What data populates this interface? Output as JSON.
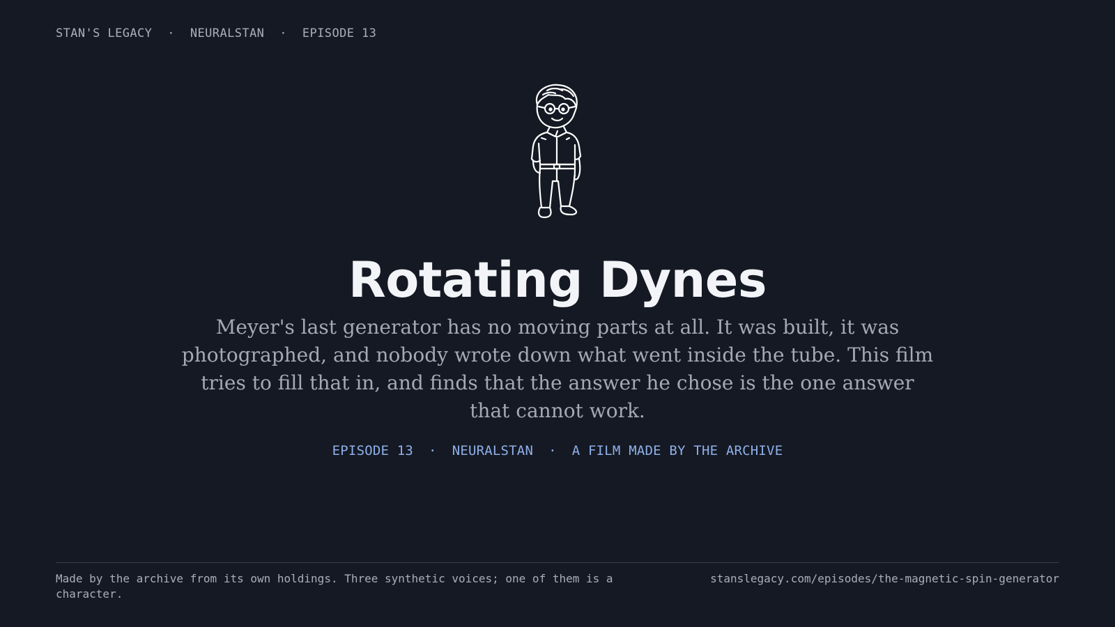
{
  "topbar": {
    "site": "STAN'S LEGACY",
    "separator": "·",
    "series": "NEURALSTAN",
    "episode": "EPISODE 13"
  },
  "hero": {
    "mascot_icon": "stan-mascot-icon",
    "title": "Rotating Dynes",
    "description": "Meyer's last generator has no moving parts at all. It was built, it was photographed, and nobody wrote down what went inside the tube. This film tries to fill that in, and finds that the answer he chose is the one answer that cannot work."
  },
  "meta": {
    "episode": "EPISODE 13",
    "separator": "·",
    "series": "NEURALSTAN",
    "credit": "A FILM MADE BY THE ARCHIVE"
  },
  "footer": {
    "note": "Made by the archive from its own holdings. Three synthetic voices; one of them is a character.",
    "url": "stanslegacy.com/episodes/the-magnetic-spin-generator"
  },
  "colors": {
    "background": "#151923",
    "title": "#f2f4f8",
    "body_text": "#a4a9b3",
    "accent_blue": "#8fb0ea",
    "muted": "#a9afba",
    "divider": "#3a3f4a"
  }
}
